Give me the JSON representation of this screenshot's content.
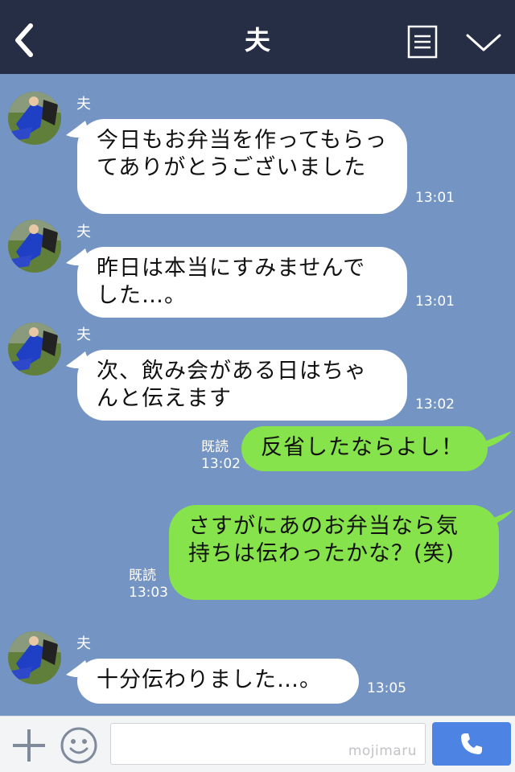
{
  "header": {
    "title": "夫"
  },
  "messages": [
    {
      "sender": "夫",
      "text": "今日もお弁当を作ってもらってありがとうございました",
      "time": "13:01"
    },
    {
      "sender": "夫",
      "text": "昨日は本当にすみませんでした…。",
      "time": "13:01"
    },
    {
      "sender": "夫",
      "text": "次、飲み会がある日はちゃんと伝えます",
      "time": "13:02"
    },
    {
      "read": "既読",
      "text": "反省したならよし！",
      "time": "13:02"
    },
    {
      "read": "既読",
      "text": "さすがにあのお弁当なら気持ちは伝わったかな？(笑)",
      "time": "13:03"
    },
    {
      "sender": "夫",
      "text": "十分伝わりました…。",
      "time": "13:05"
    }
  ],
  "footer": {
    "watermark": "mojimaru"
  },
  "colors": {
    "header_bg": "#252e44",
    "chat_bg": "#7494c3",
    "incoming_bubble": "#ffffff",
    "outgoing_bubble": "#86e34b",
    "call_button": "#4d83e3"
  },
  "icons": [
    "back-arrow-icon",
    "menu-icon",
    "chevron-down-icon",
    "plus-icon",
    "smiley-icon",
    "phone-icon"
  ]
}
